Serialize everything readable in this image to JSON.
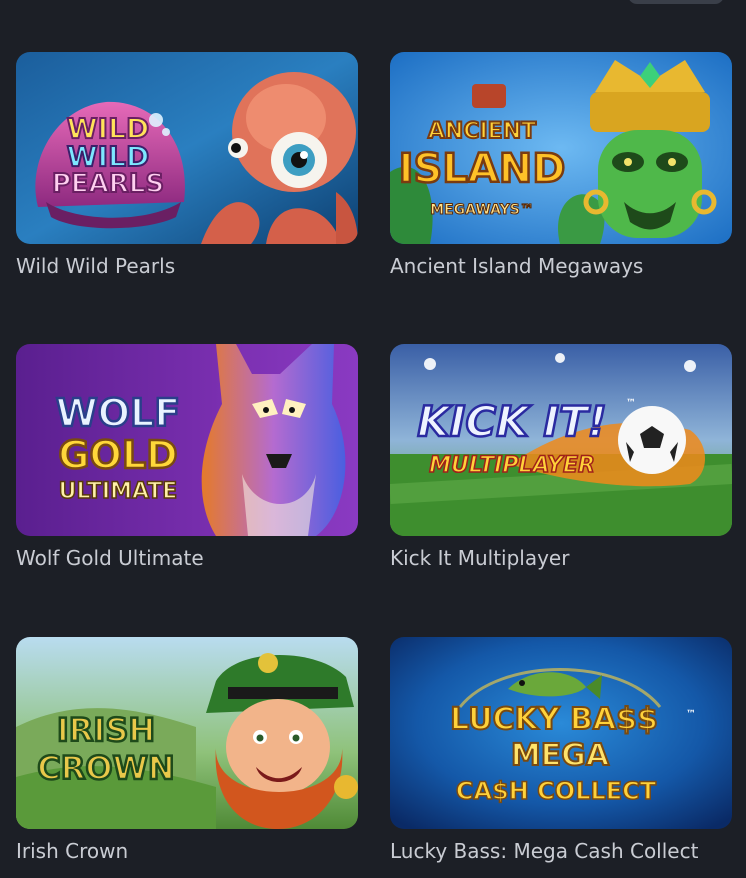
{
  "games": [
    {
      "title": "Wild Wild Pearls",
      "logo_lines": [
        "WILD",
        "WILD",
        "PEARLS"
      ],
      "image": "octopus-with-pearl-shell"
    },
    {
      "title": "Ancient Island Megaways",
      "logo_lines": [
        "ANCIENT",
        "ISLAND",
        "MEGAWAYS™"
      ],
      "image": "green-tiki-mask"
    },
    {
      "title": "Wolf Gold Ultimate",
      "logo_lines": [
        "WOLF",
        "GOLD",
        "ULTIMATE"
      ],
      "image": "wolf-portrait"
    },
    {
      "title": "Kick It Multiplayer",
      "logo_lines": [
        "KICK IT!",
        "MULTIPLAYER",
        "™"
      ],
      "image": "soccer-ball-stadium"
    },
    {
      "title": "Irish Crown",
      "logo_lines": [
        "IRISH",
        "CROWN"
      ],
      "image": "leprechaun"
    },
    {
      "title": "Lucky Bass: Mega Cash Collect",
      "logo_lines": [
        "LUCKY BA$$",
        "MEGA",
        "CA$H COLLECT",
        "™"
      ],
      "image": "bass-fish"
    }
  ]
}
